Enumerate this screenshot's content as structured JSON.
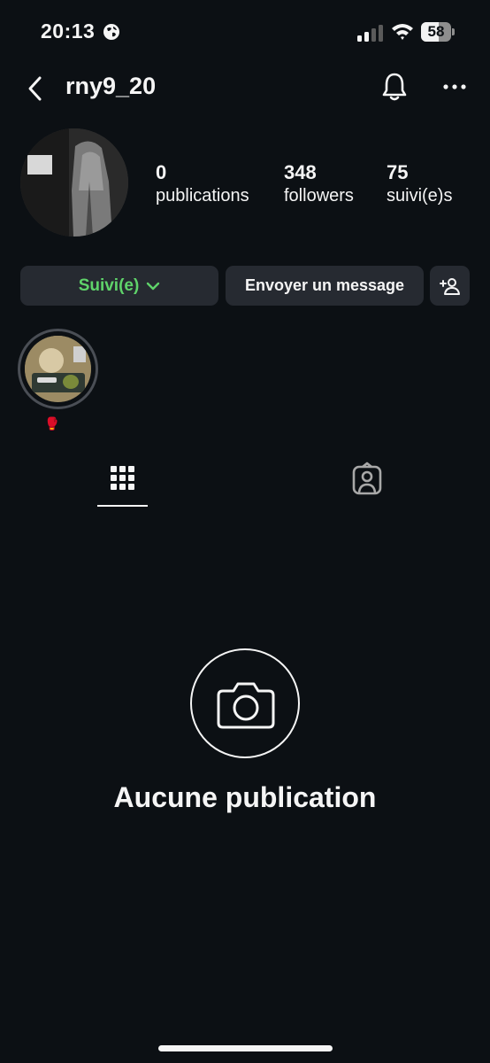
{
  "status_bar": {
    "time": "20:13",
    "battery_level": "58",
    "battery_fraction": 0.58
  },
  "header": {
    "username": "rny9_20",
    "back_icon": "chevron-left-icon",
    "bell_icon": "bell-icon",
    "more_icon": "more-horizontal-icon"
  },
  "stats": [
    {
      "value": "0",
      "label": "publications"
    },
    {
      "value": "348",
      "label": "followers"
    },
    {
      "value": "75",
      "label": "suivi(e)s"
    }
  ],
  "actions": {
    "follow_label": "Suivi(e)",
    "message_label": "Envoyer un message",
    "add_icon": "add-person-icon",
    "accent_color": "#5fd36a"
  },
  "highlights": [
    {
      "label": "🥊"
    }
  ],
  "tabs": [
    {
      "name": "grid",
      "icon": "grid-icon",
      "active": true
    },
    {
      "name": "tagged",
      "icon": "tagged-person-icon",
      "active": false
    }
  ],
  "empty_state": {
    "icon": "camera-icon",
    "title": "Aucune publication"
  },
  "colors": {
    "background": "#0c1014",
    "button": "#262a31",
    "text": "#f5f5f5"
  }
}
